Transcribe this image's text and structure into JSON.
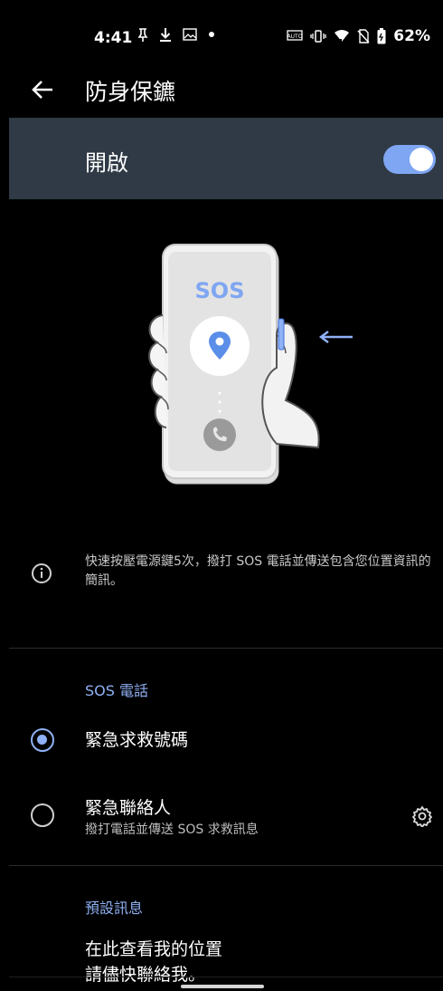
{
  "status": {
    "time": "4:41",
    "battery": "62%",
    "icons": [
      "pin-icon",
      "download-icon",
      "image-icon",
      "dot-icon",
      "auto-icon",
      "vibrate-icon",
      "wifi-icon",
      "no-sim-icon",
      "battery-icon"
    ]
  },
  "appbar": {
    "title": "防身保鑣"
  },
  "master_switch": {
    "label": "開啟",
    "state": "on"
  },
  "illustration": {
    "sos_text": "SOS"
  },
  "info": {
    "text": "快速按壓電源鍵5次，撥打 SOS 電話並傳送包含您位置資訊的簡訊。"
  },
  "sos_call": {
    "section_title": "SOS 電話",
    "options": [
      {
        "title": "緊急求救號碼",
        "selected": true
      },
      {
        "title": "緊急聯絡人",
        "subtitle": "撥打電話並傳送 SOS 求救訊息",
        "selected": false
      }
    ]
  },
  "default_message": {
    "section_title": "預設訊息",
    "line1": "在此查看我的位置",
    "line2": "請儘快聯絡我。"
  },
  "colors": {
    "accent": "#8fb1f5",
    "switch_bar": "#2f3a46"
  }
}
